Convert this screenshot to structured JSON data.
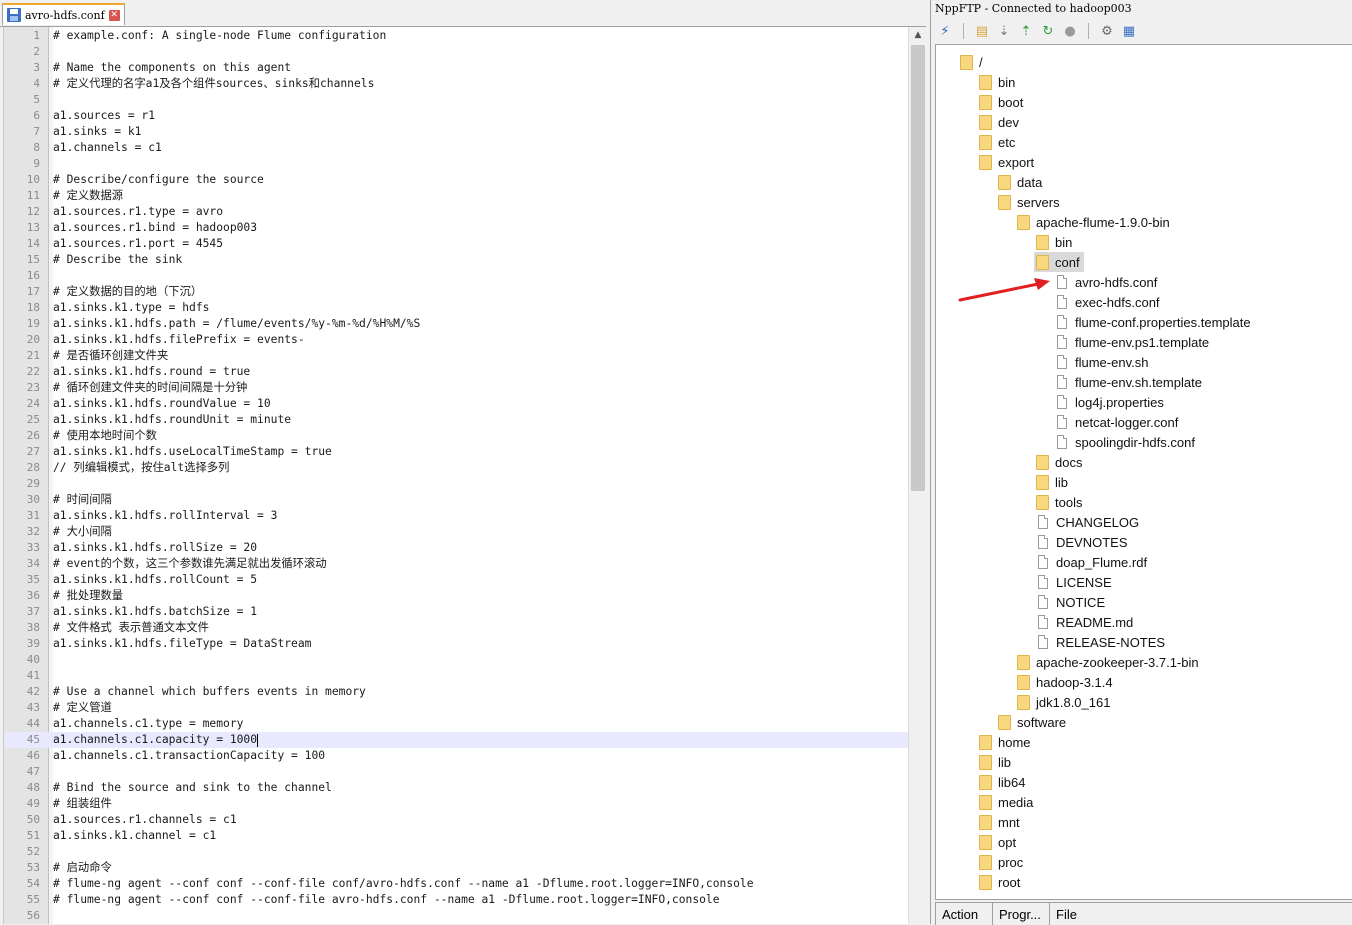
{
  "editor": {
    "tab_label": "avro-hdfs.conf",
    "current_line": 45,
    "lines": [
      "# example.conf: A single-node Flume configuration",
      "",
      "# Name the components on this agent",
      "# 定义代理的名字a1及各个组件sources、sinks和channels",
      "",
      "a1.sources = r1",
      "a1.sinks = k1",
      "a1.channels = c1",
      "",
      "# Describe/configure the source",
      "# 定义数据源",
      "a1.sources.r1.type = avro",
      "a1.sources.r1.bind = hadoop003",
      "a1.sources.r1.port = 4545",
      "# Describe the sink",
      "",
      "# 定义数据的目的地（下沉）",
      "a1.sinks.k1.type = hdfs",
      "a1.sinks.k1.hdfs.path = /flume/events/%y-%m-%d/%H%M/%S",
      "a1.sinks.k1.hdfs.filePrefix = events-",
      "# 是否循环创建文件夹",
      "a1.sinks.k1.hdfs.round = true",
      "# 循环创建文件夹的时间间隔是十分钟",
      "a1.sinks.k1.hdfs.roundValue = 10",
      "a1.sinks.k1.hdfs.roundUnit = minute",
      "# 使用本地时间个数",
      "a1.sinks.k1.hdfs.useLocalTimeStamp = true",
      "// 列编辑模式，按住alt选择多列",
      "",
      "# 时间间隔",
      "a1.sinks.k1.hdfs.rollInterval = 3",
      "# 大小间隔",
      "a1.sinks.k1.hdfs.rollSize = 20",
      "# event的个数，这三个参数谁先满足就出发循环滚动",
      "a1.sinks.k1.hdfs.rollCount = 5",
      "# 批处理数量",
      "a1.sinks.k1.hdfs.batchSize = 1",
      "# 文件格式 表示普通文本文件",
      "a1.sinks.k1.hdfs.fileType = DataStream",
      "",
      "",
      "# Use a channel which buffers events in memory",
      "# 定义管道",
      "a1.channels.c1.type = memory",
      "a1.channels.c1.capacity = 1000",
      "a1.channels.c1.transactionCapacity = 100",
      "",
      "# Bind the source and sink to the channel",
      "# 组装组件",
      "a1.sources.r1.channels = c1",
      "a1.sinks.k1.channel = c1",
      "",
      "# 启动命令",
      "# flume-ng agent --conf conf --conf-file conf/avro-hdfs.conf --name a1 -Dflume.root.logger=INFO,console",
      "# flume-ng agent --conf conf --conf-file avro-hdfs.conf --name a1 -Dflume.root.logger=INFO,console",
      ""
    ]
  },
  "ftp": {
    "title": "NppFTP - Connected to hadoop003",
    "toolbar_icons": [
      "connect-icon",
      "open-folder-icon",
      "download-icon",
      "upload-icon",
      "refresh-icon",
      "abort-icon",
      "settings-icon",
      "message-window-icon"
    ],
    "tree": [
      {
        "label": "/",
        "type": "folder",
        "depth": 0
      },
      {
        "label": "bin",
        "type": "folder",
        "depth": 1
      },
      {
        "label": "boot",
        "type": "folder",
        "depth": 1
      },
      {
        "label": "dev",
        "type": "folder",
        "depth": 1
      },
      {
        "label": "etc",
        "type": "folder",
        "depth": 1
      },
      {
        "label": "export",
        "type": "folder",
        "depth": 1
      },
      {
        "label": "data",
        "type": "folder",
        "depth": 2
      },
      {
        "label": "servers",
        "type": "folder",
        "depth": 2
      },
      {
        "label": "apache-flume-1.9.0-bin",
        "type": "folder",
        "depth": 3
      },
      {
        "label": "bin",
        "type": "folder",
        "depth": 4
      },
      {
        "label": "conf",
        "type": "folder",
        "depth": 4,
        "selected": true
      },
      {
        "label": "avro-hdfs.conf",
        "type": "file",
        "depth": 5
      },
      {
        "label": "exec-hdfs.conf",
        "type": "file",
        "depth": 5
      },
      {
        "label": "flume-conf.properties.template",
        "type": "file",
        "depth": 5
      },
      {
        "label": "flume-env.ps1.template",
        "type": "file",
        "depth": 5
      },
      {
        "label": "flume-env.sh",
        "type": "file",
        "depth": 5
      },
      {
        "label": "flume-env.sh.template",
        "type": "file",
        "depth": 5
      },
      {
        "label": "log4j.properties",
        "type": "file",
        "depth": 5
      },
      {
        "label": "netcat-logger.conf",
        "type": "file",
        "depth": 5
      },
      {
        "label": "spoolingdir-hdfs.conf",
        "type": "file",
        "depth": 5
      },
      {
        "label": "docs",
        "type": "folder",
        "depth": 4
      },
      {
        "label": "lib",
        "type": "folder",
        "depth": 4
      },
      {
        "label": "tools",
        "type": "folder",
        "depth": 4
      },
      {
        "label": "CHANGELOG",
        "type": "file",
        "depth": 4
      },
      {
        "label": "DEVNOTES",
        "type": "file",
        "depth": 4
      },
      {
        "label": "doap_Flume.rdf",
        "type": "file",
        "depth": 4
      },
      {
        "label": "LICENSE",
        "type": "file",
        "depth": 4
      },
      {
        "label": "NOTICE",
        "type": "file",
        "depth": 4
      },
      {
        "label": "README.md",
        "type": "file",
        "depth": 4
      },
      {
        "label": "RELEASE-NOTES",
        "type": "file",
        "depth": 4
      },
      {
        "label": "apache-zookeeper-3.7.1-bin",
        "type": "folder",
        "depth": 3
      },
      {
        "label": "hadoop-3.1.4",
        "type": "folder",
        "depth": 3
      },
      {
        "label": "jdk1.8.0_161",
        "type": "folder",
        "depth": 3
      },
      {
        "label": "software",
        "type": "folder",
        "depth": 2
      },
      {
        "label": "home",
        "type": "folder",
        "depth": 1
      },
      {
        "label": "lib",
        "type": "folder",
        "depth": 1
      },
      {
        "label": "lib64",
        "type": "folder",
        "depth": 1
      },
      {
        "label": "media",
        "type": "folder",
        "depth": 1
      },
      {
        "label": "mnt",
        "type": "folder",
        "depth": 1
      },
      {
        "label": "opt",
        "type": "folder",
        "depth": 1
      },
      {
        "label": "proc",
        "type": "folder",
        "depth": 1
      },
      {
        "label": "root",
        "type": "folder",
        "depth": 1
      }
    ],
    "bottom_tabs": [
      "Action",
      "Progr...",
      "File"
    ]
  },
  "colors": {
    "annotation_arrow": "#e02020",
    "current_line_highlight": "#e8e8ff",
    "tab_accent": "#f0a830"
  }
}
